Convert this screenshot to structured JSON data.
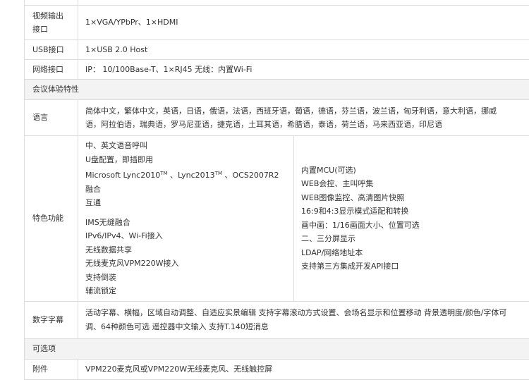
{
  "rows": {
    "video_out": {
      "label_1": "视频输出",
      "label_2": "接口",
      "value": "1×VGA/YPbPr、1×HDMI"
    },
    "usb": {
      "label": "USB接口",
      "value": "1×USB 2.0 Host"
    },
    "network": {
      "label": "网络接口",
      "value": "IP： 10/100Base-T、1×RJ45 无线：内置Wi-Fi"
    }
  },
  "section_meeting": "会议体验特性",
  "language": {
    "label": "语言",
    "line1": "简体中文，繁体中文，英语，日语，俄语，法语，西班牙语，葡语，德语，芬兰语，波兰语，匈牙利语，意大利语，挪威",
    "line2": "语，阿拉伯语，瑞典语，罗马尼亚语，捷克语，土耳其语，希腊语，泰语，荷兰语，马来西亚语，印尼语"
  },
  "features": {
    "label": "特色功能",
    "left": {
      "l1": "中、英文语音呼叫",
      "l2": "U盘配置，即插即用",
      "lync_a": "Microsoft Lync2010",
      "tm1": "TM",
      "lync_b": " 、Lync2013",
      "tm2": "TM",
      "lync_c": " 、OCS2007R2 融合",
      "lync_d": "互通",
      "l5": "IMS无缝融合",
      "l6": "IPv6/IPv4、Wi-Fi接入",
      "l7": "无线数据共享",
      "l8": "无线麦克风VPM220W接入",
      "l9": "支持倒装",
      "l10": "辅流锁定"
    },
    "right": [
      "内置MCU(可选)",
      "WEB会控、主叫呼集",
      "WEB图像监控、高清图片快照",
      "16:9和4:3显示模式适配和转换",
      "画中画：1/16画面大小、位置可选",
      "二、三分屏显示",
      "LDAP/网络地址本",
      "支持第三方集成开发API接口"
    ]
  },
  "subtitle": {
    "label": "数字字幕",
    "line1": "活动字幕、横幅，区域自动调整、自适应实景编辑 支持字幕滚动方式设置、会场名显示和位置移动 背景透明度/颜色/字体可",
    "line2": "调、64种颜色可选 遥控器中文输入 支持T.140短消息"
  },
  "section_optional": "可选项",
  "accessory": {
    "label": "附件",
    "value": "VPM220麦克风或VPM220W无线麦克风、无线触控屏"
  }
}
